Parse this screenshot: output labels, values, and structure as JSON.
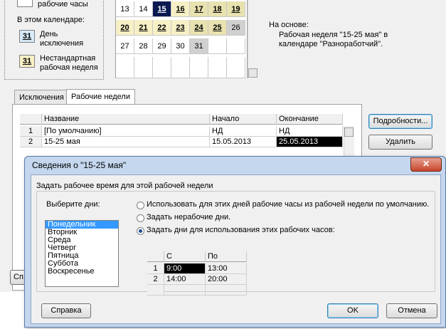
{
  "legend": {
    "top_label": "рабочие часы",
    "in_calendar_label": "В этом календаре:",
    "exception_box": "31",
    "exception_label": "День исключения",
    "nonstandard_box": "31",
    "nonstandard_label": "Нестандартная рабочая неделя"
  },
  "calendar": {
    "rows": [
      [
        "13",
        "14",
        "15",
        "16",
        "17",
        "18",
        "19"
      ],
      [
        "20",
        "21",
        "22",
        "23",
        "24",
        "25",
        "26"
      ],
      [
        "27",
        "28",
        "29",
        "30",
        "31",
        "",
        ""
      ]
    ]
  },
  "based_on": {
    "label": "На основе:",
    "description": "Рабочая неделя \"15-25 мая\" в календаре \"Разноработчий\"."
  },
  "tabs": {
    "exceptions": "Исключения",
    "work_weeks": "Рабочие недели"
  },
  "weeks_table": {
    "headers": {
      "name": "Название",
      "start": "Начало",
      "end": "Окончание"
    },
    "rows": [
      {
        "num": "1",
        "name": "[По умолчанию]",
        "start": "НД",
        "end": "НД"
      },
      {
        "num": "2",
        "name": "15-25 мая",
        "start": "15.05.2013",
        "end": "25.05.2013"
      }
    ]
  },
  "buttons": {
    "details": "Подробности...",
    "delete": "Удалить",
    "help_bg_partial": "Сп"
  },
  "dialog": {
    "title": "Сведения о \"15-25 мая\"",
    "close_glyph": "✕",
    "group_label": "Задать рабочее время для этой рабочей недели",
    "select_days_label": "Выберите дни:",
    "days": [
      "Понедельник",
      "Вторник",
      "Среда",
      "Четверг",
      "Пятница",
      "Суббота",
      "Воскресенье"
    ],
    "selected_day": "Понедельник",
    "radio_default": "Использовать для этих дней рабочие часы из рабочей недели по умолчанию.",
    "radio_nonworking": "Задать нерабочие дни.",
    "radio_specific": "Задать дни для использования этих рабочих часов:",
    "selected_radio": "specific",
    "times_table": {
      "headers": {
        "from": "С",
        "to": "По"
      },
      "rows": [
        {
          "num": "1",
          "from": "9:00",
          "to": "13:00"
        },
        {
          "num": "2",
          "from": "14:00",
          "to": "20:00"
        }
      ]
    },
    "help_button": "Справка",
    "ok_button": "OK",
    "cancel_button": "Отмена"
  }
}
